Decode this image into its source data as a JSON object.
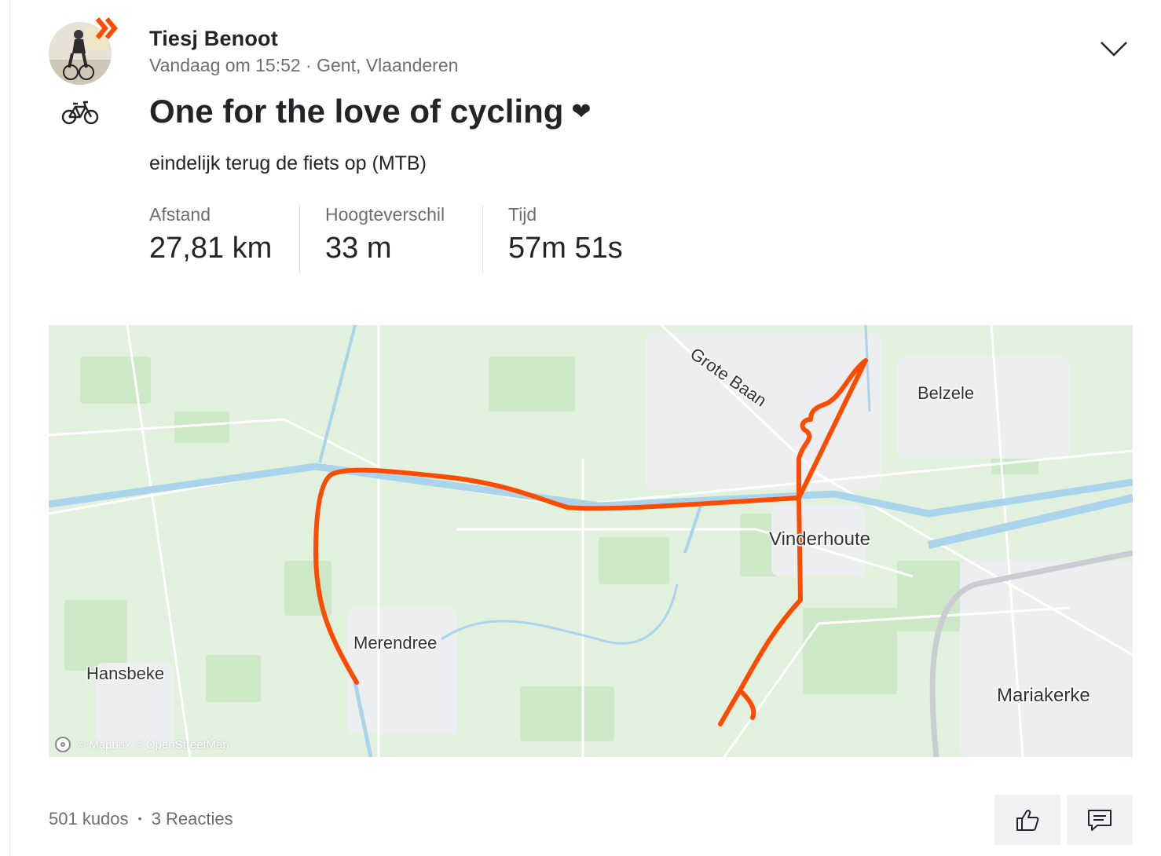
{
  "athlete": {
    "name": "Tiesj Benoot",
    "meta": "Vandaag om 15:52 · Gent, Vlaanderen",
    "avatar_icon": "athlete-avatar",
    "badge_icon": "subscriber-chevrons-icon",
    "activity_icon": "bicycle-icon"
  },
  "activity": {
    "title": "One for the love of cycling",
    "title_emoji": "❤",
    "description": "eindelijk terug de fiets op (MTB)"
  },
  "stats": [
    {
      "label": "Afstand",
      "value": "27,81 km"
    },
    {
      "label": "Hoogteverschil",
      "value": "33 m"
    },
    {
      "label": "Tijd",
      "value": "57m 51s"
    }
  ],
  "map": {
    "place_labels": {
      "grote_baan": "Grote Baan",
      "belzele": "Belzele",
      "vinderhoute": "Vinderhoute",
      "merendree": "Merendree",
      "hansbeke": "Hansbeke",
      "mariakerke": "Mariakerke"
    },
    "attribution": "© Mapbox © OpenStreetMap",
    "route_color": "#fc4c02"
  },
  "footer": {
    "kudos": "501 kudos",
    "separator": "•",
    "comments": "3 Reacties",
    "kudos_button_icon": "thumbs-up-icon",
    "comment_button_icon": "comment-icon"
  },
  "colors": {
    "brand": "#fc4c02",
    "text": "#242428",
    "muted": "#6d6d78"
  }
}
